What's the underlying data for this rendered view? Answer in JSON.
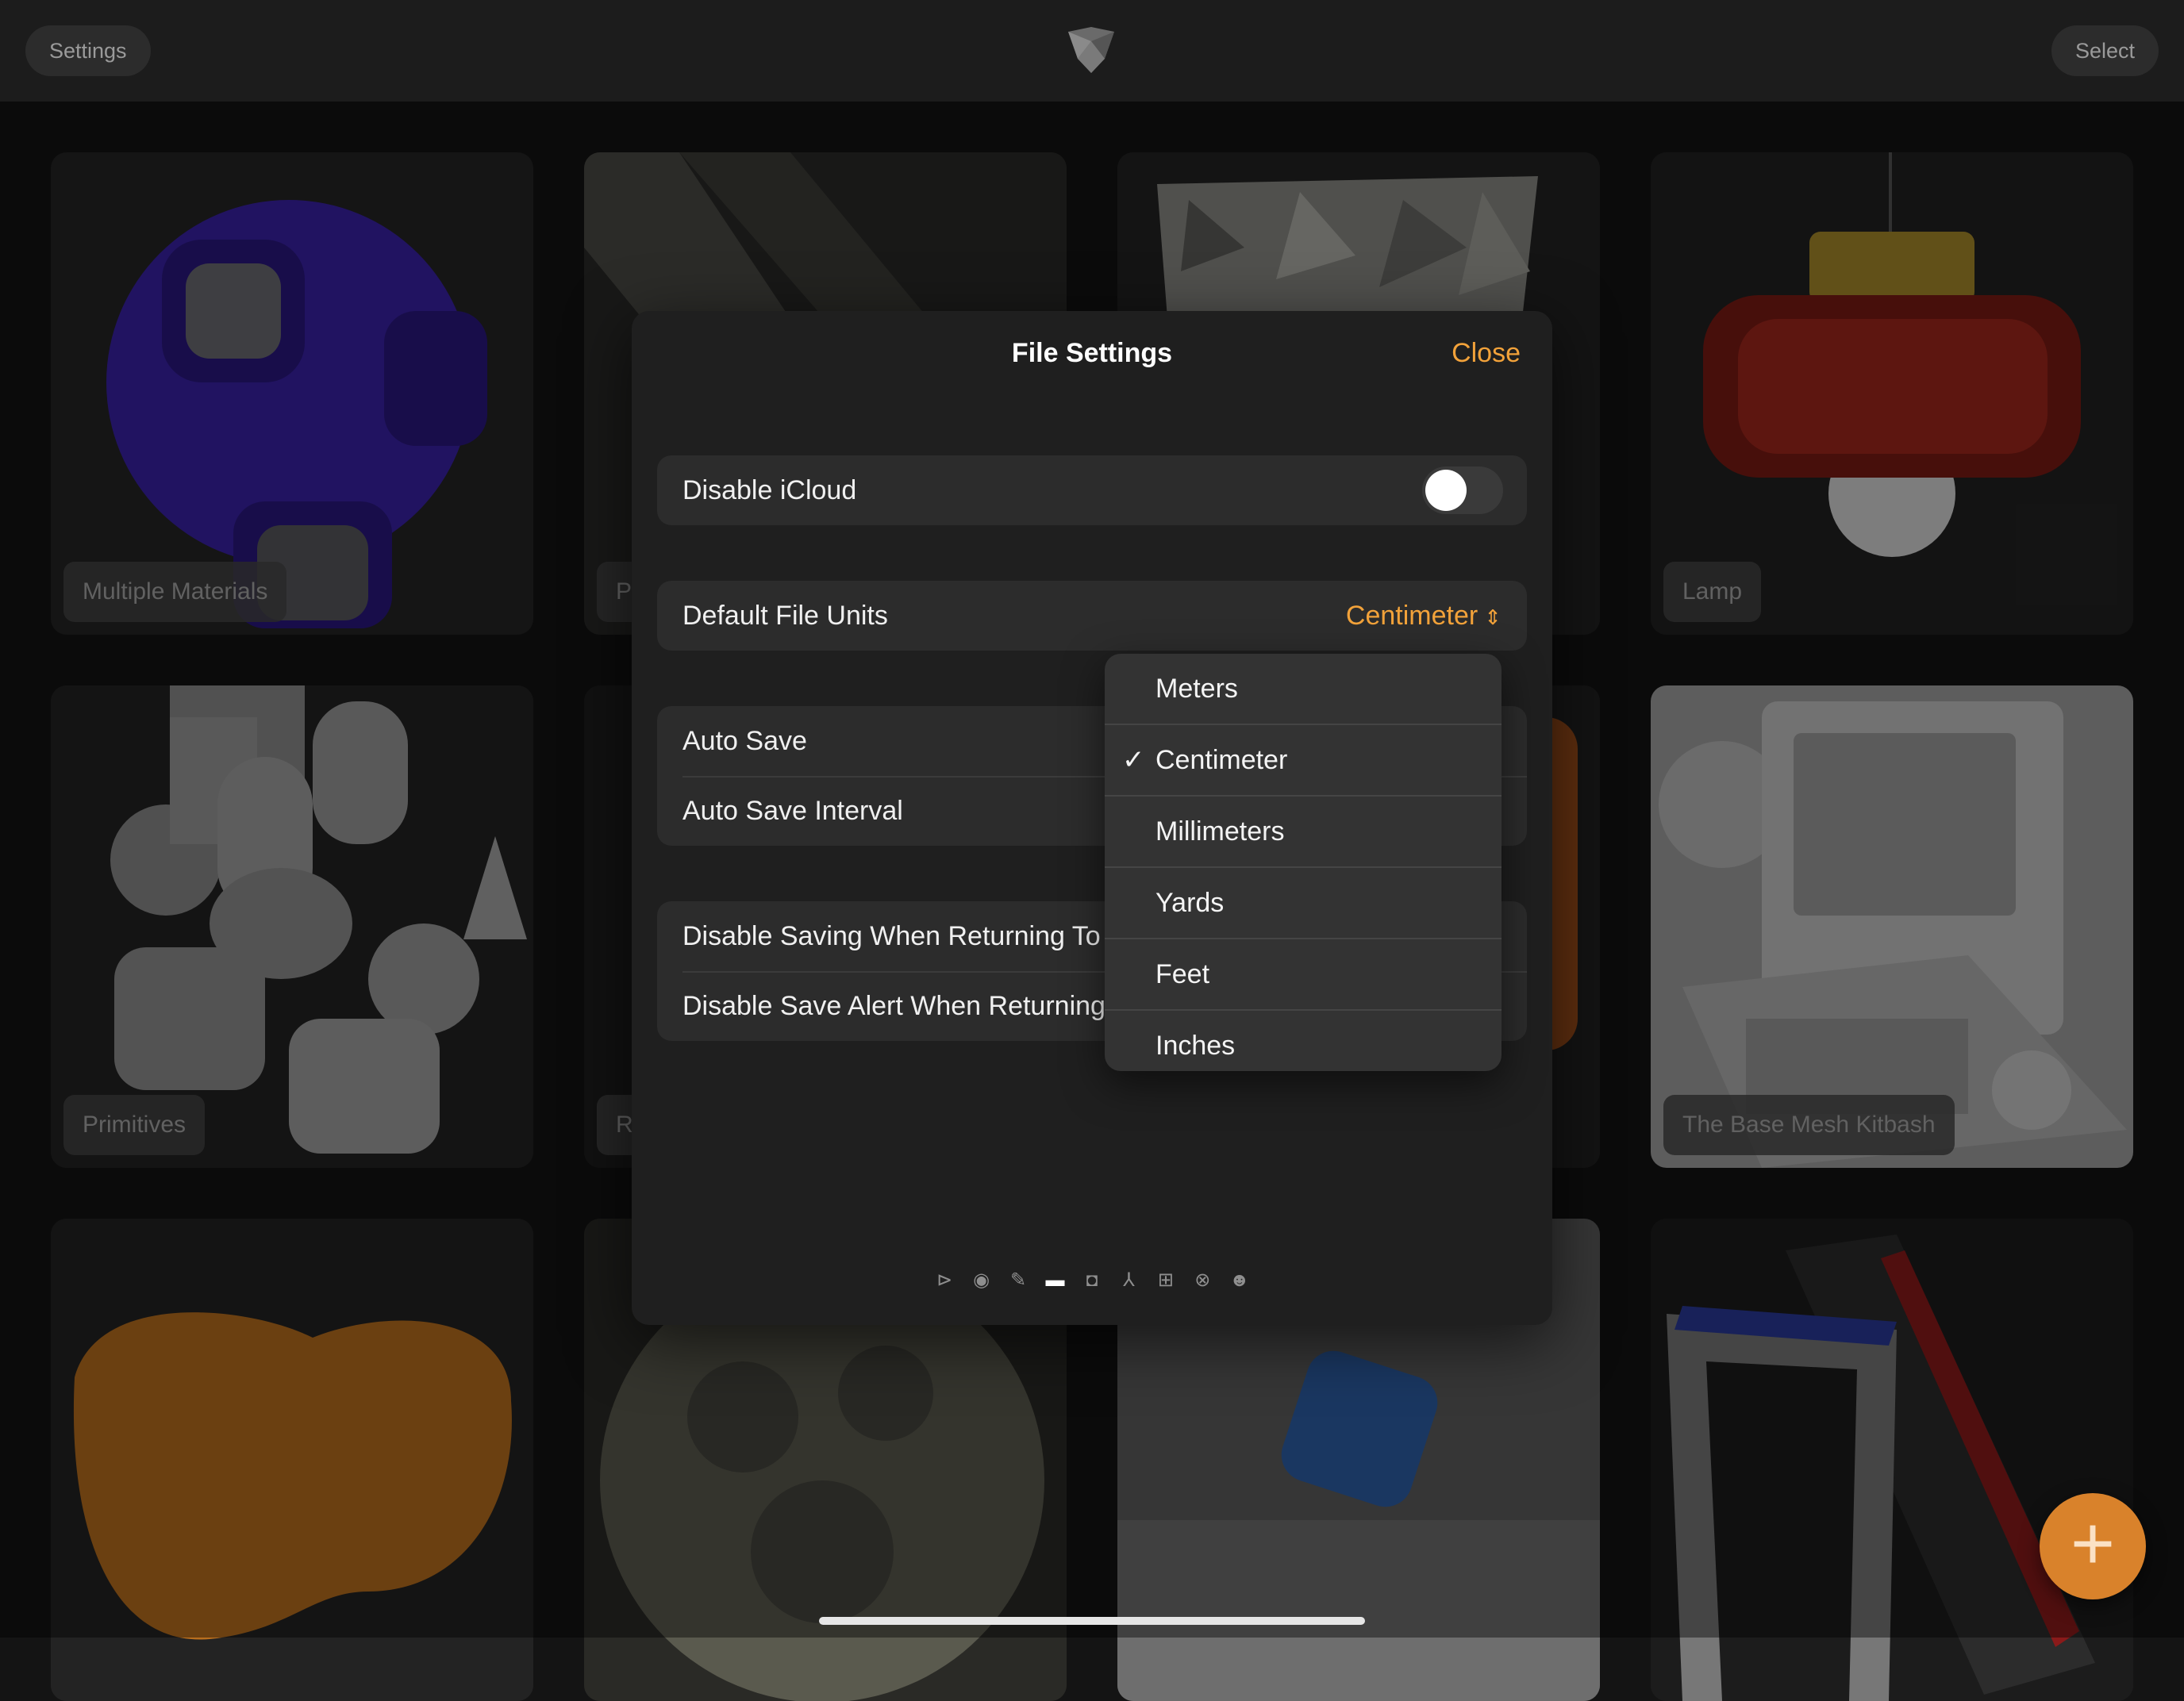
{
  "topbar": {
    "settings_label": "Settings",
    "select_label": "Select",
    "logo_icon": "app-logo-icon"
  },
  "gallery": {
    "cards": [
      {
        "label": "Multiple Materials"
      },
      {
        "label": "P"
      },
      {
        "label": ""
      },
      {
        "label": "Lamp"
      },
      {
        "label": "Primitives"
      },
      {
        "label": "R"
      },
      {
        "label": ""
      },
      {
        "label": "The Base Mesh Kitbash"
      },
      {
        "label": ""
      },
      {
        "label": ""
      },
      {
        "label": ""
      },
      {
        "label": ""
      }
    ]
  },
  "modal": {
    "title": "File Settings",
    "close_label": "Close",
    "disable_icloud": {
      "label": "Disable iCloud",
      "on": false
    },
    "default_units": {
      "label": "Default File Units",
      "value": "Centimeter"
    },
    "auto_save": {
      "label": "Auto Save"
    },
    "auto_save_interval": {
      "label": "Auto Save Interval"
    },
    "disable_saving": {
      "label": "Disable Saving When Returning To"
    },
    "disable_alert": {
      "label": "Disable Save Alert When Returning"
    },
    "toolbar_icons": [
      "play-icon",
      "palette-icon",
      "brush-icon",
      "folder-icon",
      "camera-icon",
      "axes-icon",
      "grid-icon",
      "ball-icon",
      "people-icon"
    ],
    "active_toolbar_icon": "folder-icon"
  },
  "units_menu": {
    "options": [
      "Meters",
      "Centimeter",
      "Millimeters",
      "Yards",
      "Feet",
      "Inches"
    ],
    "selected": "Centimeter",
    "check_mark": "✓"
  },
  "fab": {
    "label": "+"
  },
  "colors": {
    "accent": "#f2a23a",
    "fab": "#d9822b"
  }
}
